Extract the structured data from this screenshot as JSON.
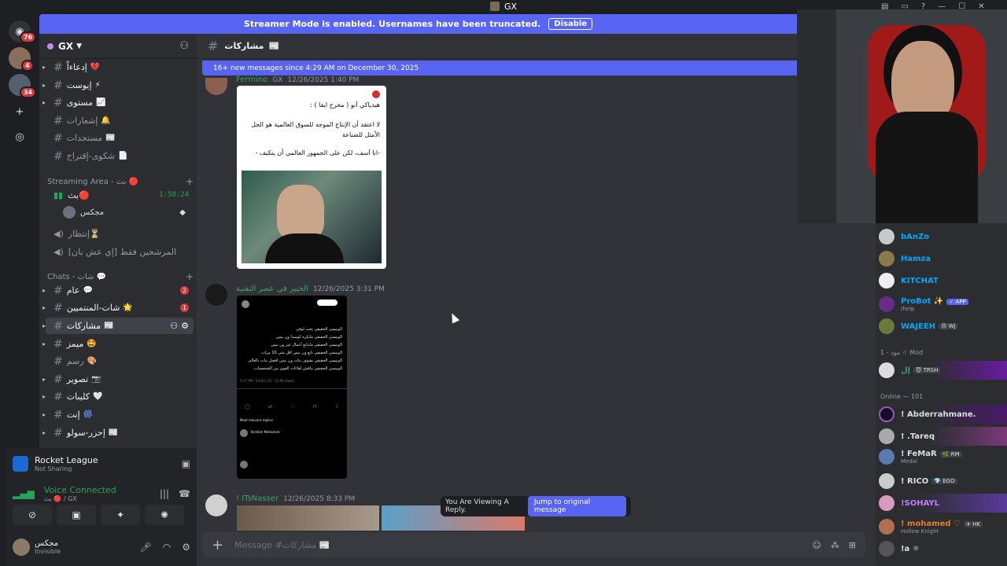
{
  "window": {
    "title": "GX",
    "controls": [
      "—",
      "☐",
      "✕"
    ]
  },
  "guilds": {
    "home_badge": "76",
    "items": [
      {
        "badge": "4"
      },
      {
        "badge": "34"
      }
    ],
    "add_icon": "plus-icon",
    "explore_icon": "compass-icon"
  },
  "banner": {
    "text": "Streamer Mode is enabled. Usernames have been truncated.",
    "button": "Disable"
  },
  "server": {
    "name": "GX"
  },
  "channels": {
    "top": [
      {
        "name": "إدعاءاً",
        "emoji": "💔"
      },
      {
        "name": "إيوست",
        "emoji": "⚡"
      },
      {
        "name": "مستوى",
        "emoji": "📈"
      },
      {
        "name": "إشعارات",
        "emoji": "🔔"
      },
      {
        "name": "مستجدات",
        "emoji": "📰"
      },
      {
        "name": "شكوى-إقتراح",
        "emoji": "📄"
      }
    ],
    "streaming_category": "Streaming Area - بث 🔴",
    "voice": [
      {
        "name": "بث",
        "emoji": "🔴",
        "timer": "1:58:24"
      },
      {
        "name": "إنتظار",
        "emoji": "⏳"
      },
      {
        "name": "المرشحين فقط [إي عش بان]",
        "emoji": ""
      }
    ],
    "voice_user": "مجكس",
    "chats_category": "Chats - شات 💬",
    "chats": [
      {
        "name": "عام",
        "emoji": "💬",
        "count": "2"
      },
      {
        "name": "شات-المنتميين",
        "emoji": "🌟",
        "count": "1"
      },
      {
        "name": "مشاركات",
        "emoji": "📰",
        "active": true
      },
      {
        "name": "ميمز",
        "emoji": "🤩"
      },
      {
        "name": "رسم",
        "emoji": "🎨"
      },
      {
        "name": "تصوير",
        "emoji": "📷"
      },
      {
        "name": "كليبات",
        "emoji": "🤍"
      },
      {
        "name": "إنت",
        "emoji": "🎆"
      },
      {
        "name": "إحزر-سولو",
        "emoji": "📰"
      }
    ]
  },
  "user_panel": {
    "activity": {
      "title": "Rocket League",
      "sub": "Not Sharing"
    },
    "voice": {
      "title": "Voice Connected",
      "sub": "بث 🔴 / GX"
    },
    "user": {
      "name": "مجكس",
      "status": "Invisible"
    }
  },
  "chat": {
    "channel": "مشاركات",
    "channel_emoji": "📰",
    "new_messages": "16+ new messages since 4:29 AM on December 30, 2025",
    "messages": [
      {
        "author": "Fermino",
        "tag": "GX",
        "time": "12/26/2025 1:40 PM",
        "card_lines": [
          "هيدياكي أنو ( مخرج ايفا ) :",
          "لا اعتقد أن الإنتاج الموجه للسوق العالمية هو الحل الأمثل للصناعة",
          "-انا آسف، لكن على الجمهور العالمي أن يتكيف -"
        ]
      },
      {
        "author": "الخبير في عصر التقنية",
        "time": "12/26/2025 3:31 PM",
        "tweet_lines": [
          "الونيسي الحقيقي يحب لوفي",
          "الونيسي الحقيقي مايكره كوميدا ون بيس",
          "الونيسي الحقيقي مايتابع أعمال غير ون بيس",
          "الونيسي الحقيقي تابع ون بيس أقل شي 10 مرات",
          "الونيسي الحقيقي يشوف بنات ون بيس افضل بنات بالعالم",
          "الونيسي الحقيقي يناقش لقاءات القوى بين الشخصيات"
        ],
        "tweet_time": "5:17 PM · 04 Dec 25 · 13.9K Views",
        "replies_label": "Most relevant replies",
        "reply_author": "Ibrahim Mohamed"
      },
      {
        "author": "! ITsNasser",
        "time": "12/26/2025 8:33 PM"
      }
    ],
    "reply_bar": {
      "text": "You Are Viewing A Reply.",
      "button": "Jump to original message"
    },
    "composer_placeholder": "Message #مشاركات 📰"
  },
  "members": {
    "top": [
      {
        "name": "bAnZo",
        "color": "#00a8fc"
      },
      {
        "name": "Hamza",
        "color": "#00a8fc"
      },
      {
        "name": "KITCHAT",
        "color": "#00a8fc"
      },
      {
        "name": "ProBot ✨",
        "color": "#00a8fc",
        "app": "✓ APP",
        "sub": "/help"
      },
      {
        "name": "WAJEEH",
        "color": "#00a8fc",
        "tag": "😠 WJ"
      }
    ],
    "mod_category": "مود - 1 ☆ Mod",
    "mod": [
      {
        "name": "إل",
        "tag": "😈 TRSH"
      }
    ],
    "online_category": "Online — 101",
    "online": [
      {
        "name": "! Abderrahmane."
      },
      {
        "name": "! .Tareq"
      },
      {
        "name": "! FeMaR",
        "tag": "🌿 RM",
        "sub": "Medal"
      },
      {
        "name": "! RICO",
        "tag": "💎 EGO"
      },
      {
        "name": "!SOHAYL",
        "color": "#c27cff"
      },
      {
        "name": "! mohamed ♡",
        "tag": "✈ HK",
        "sub": "Hollow Knight",
        "color": "#e67e22"
      },
      {
        "name": "!a ⚛"
      }
    ]
  }
}
